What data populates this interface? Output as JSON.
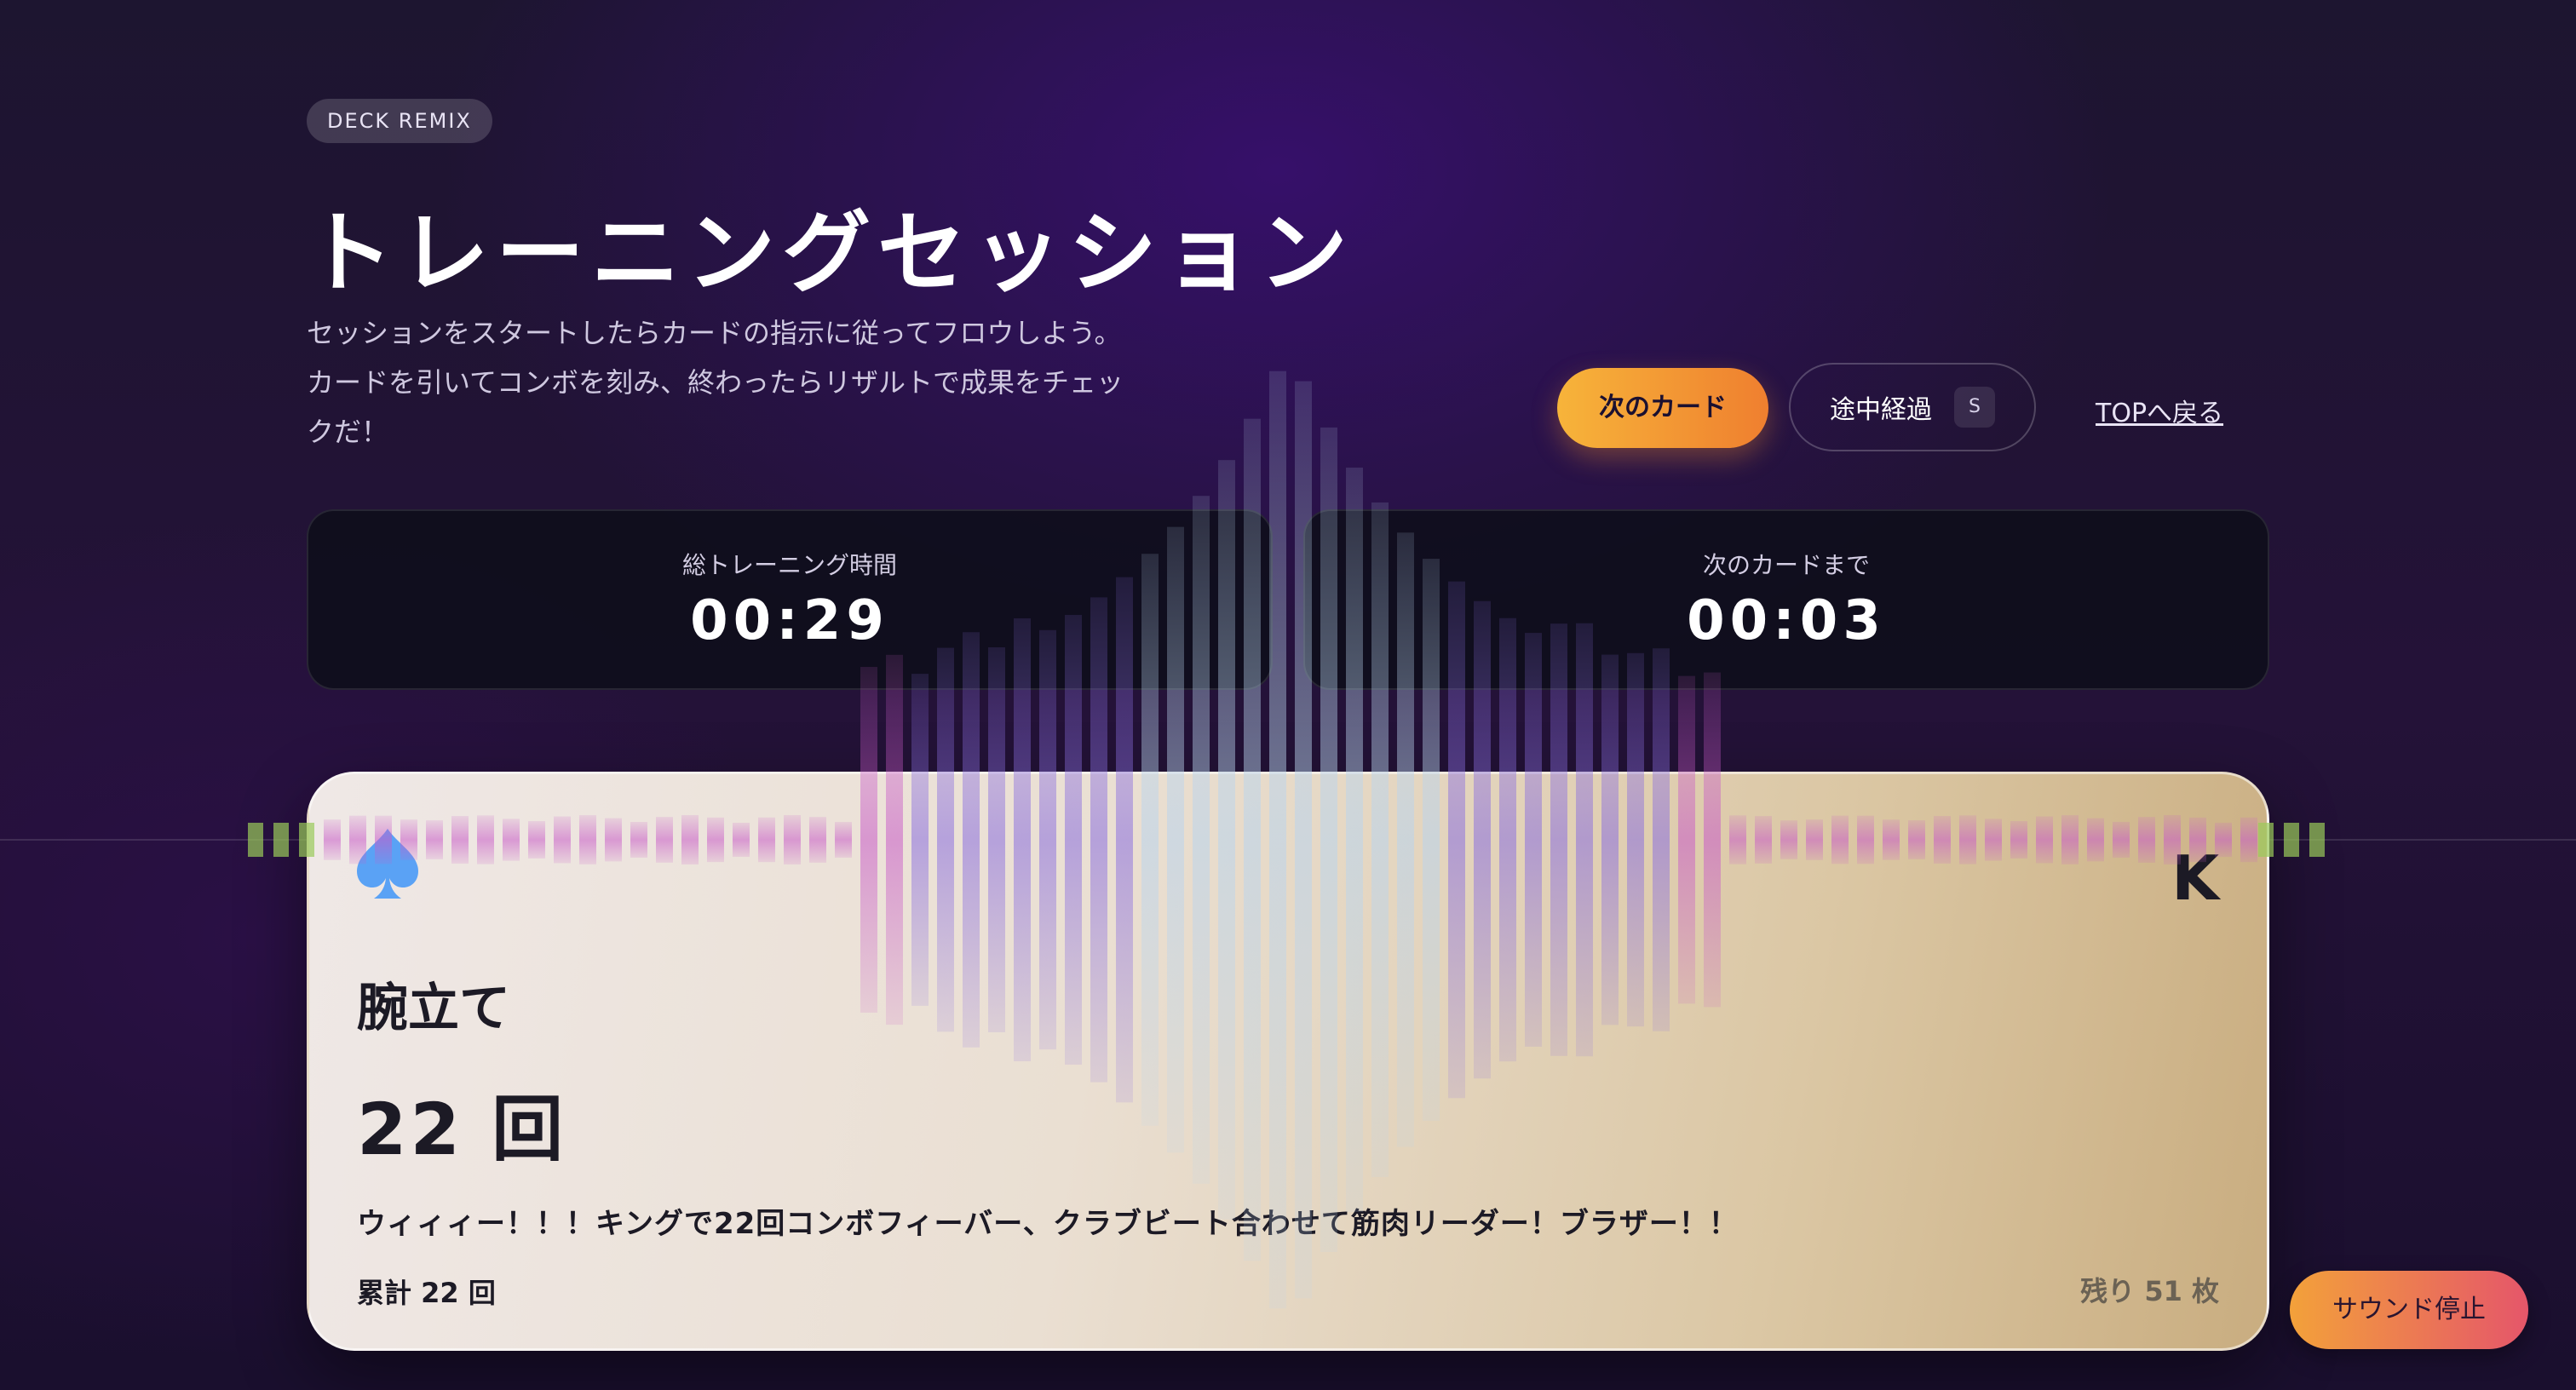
{
  "header": {
    "badge": "DECK REMIX",
    "title": "トレーニングセッション",
    "description_lines": [
      "セッションをスタートしたらカードの指示に従ってフロウしよう。",
      "カードを引いてコンボを刻み、終わったらリザルトで成果をチェッ",
      "クだ！"
    ]
  },
  "actions": {
    "next_card": "次のカード",
    "progress": "途中経過",
    "progress_shortcut": "S",
    "back_top": "TOPへ戻る"
  },
  "timers": {
    "total": {
      "label": "総トレーニング時間",
      "value": "00:29"
    },
    "next": {
      "label": "次のカードまで",
      "value": "00:03"
    }
  },
  "card": {
    "suit_icon": "spade-icon",
    "suit_color": "#5aa2f5",
    "rank": "K",
    "exercise": "腕立て",
    "reps": "22 回",
    "message": "ウィィィー！！！キングで22回コンボフィーバー、クラブビート合わせて筋肉リーダー！ブラザー！！",
    "total": "累計 22 回",
    "remaining": "残り 51 枚"
  },
  "sound": {
    "stop_label": "サウンド停止"
  },
  "colors": {
    "accent_orange": "#f7b43a",
    "sound_gradient_end": "#e5566a",
    "visualizer_center": "#b9d4ee",
    "visualizer_mid": "#8a6ee0",
    "visualizer_edge": "#c85ac8"
  }
}
